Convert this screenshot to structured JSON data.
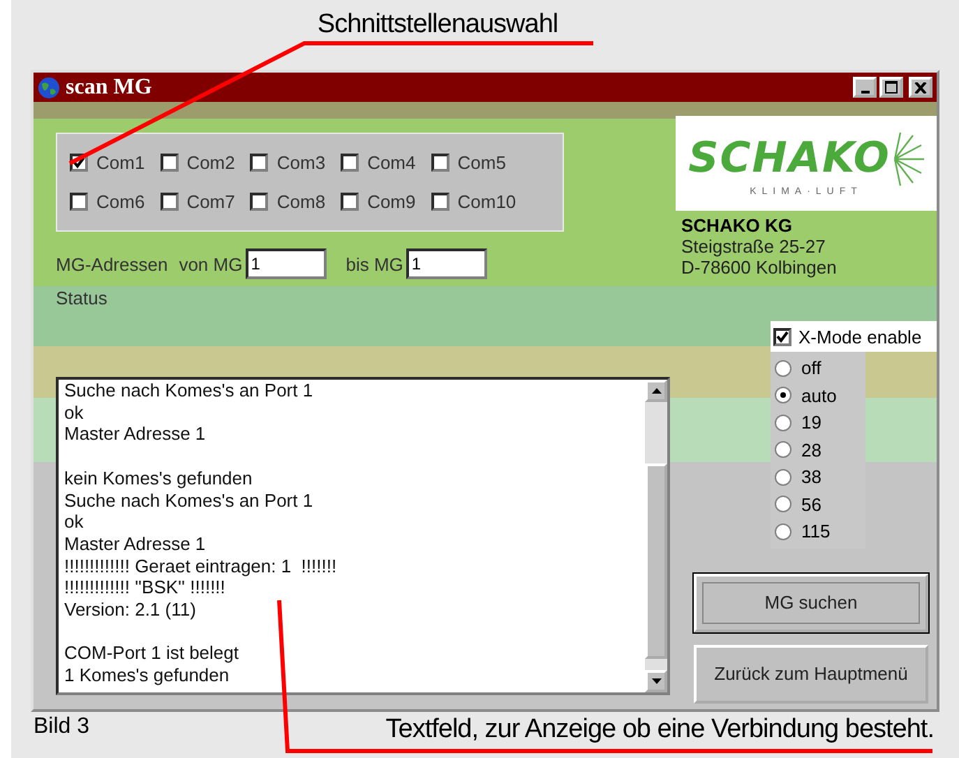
{
  "annotation_top": "Schnittstellenauswahl",
  "window": {
    "title": "scan MG"
  },
  "ports": [
    {
      "label": "Com1",
      "checked": true
    },
    {
      "label": "Com2",
      "checked": false
    },
    {
      "label": "Com3",
      "checked": false
    },
    {
      "label": "Com4",
      "checked": false
    },
    {
      "label": "Com5",
      "checked": false
    },
    {
      "label": "Com6",
      "checked": false
    },
    {
      "label": "Com7",
      "checked": false
    },
    {
      "label": "Com8",
      "checked": false
    },
    {
      "label": "Com9",
      "checked": false
    },
    {
      "label": "Com10",
      "checked": false
    }
  ],
  "addresses": {
    "label": "MG-Adressen",
    "from_label": "von MG",
    "from_value": "1",
    "to_label": "bis MG",
    "to_value": "1"
  },
  "status_label": "Status",
  "log": [
    [
      "Suche nach Komes's an Port 1",
      "ok",
      "Master Adresse 1"
    ],
    [
      "kein Komes's gefunden",
      "Suche nach Komes's an Port 1",
      "ok",
      "Master Adresse 1",
      "!!!!!!!!!!!!! Geraet eintragen: 1  !!!!!!!",
      "!!!!!!!!!!!!! ''BSK'' !!!!!!!",
      "Version: 2.1 (11)"
    ],
    [
      "COM-Port 1 ist belegt",
      "1 Komes's gefunden"
    ]
  ],
  "logo": {
    "wordmark": "SCHAKO",
    "tagline": "KLIMA·LUFT"
  },
  "company": {
    "name": "SCHAKO KG",
    "street": "Steigstraße 25-27",
    "city": "D-78600 Kolbingen"
  },
  "xmode": {
    "label": "X-Mode enable",
    "checked": true
  },
  "modes": [
    {
      "label": "off",
      "selected": false
    },
    {
      "label": "auto",
      "selected": true
    },
    {
      "label": "19",
      "selected": false
    },
    {
      "label": "28",
      "selected": false
    },
    {
      "label": "38",
      "selected": false
    },
    {
      "label": "56",
      "selected": false
    },
    {
      "label": "115",
      "selected": false
    }
  ],
  "buttons": [
    {
      "label": "MG suchen",
      "focused": true
    },
    {
      "label": "Zurück zum Hauptmenü",
      "focused": false
    }
  ],
  "caption": "Bild 3",
  "annotation_bottom": "Textfeld, zur Anzeige ob eine Verbindung besteht."
}
